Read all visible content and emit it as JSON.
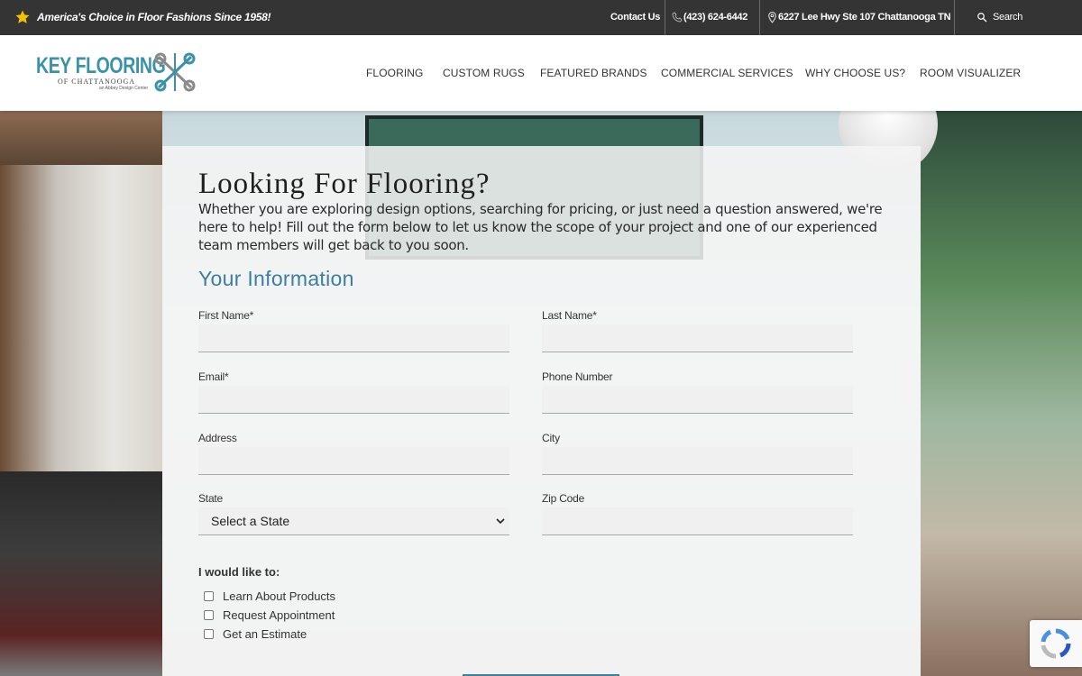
{
  "topbar": {
    "tagline": "America's Choice in Floor Fashions Since 1958!",
    "contact_label": "Contact Us",
    "phone": "(423) 624-6442",
    "address": "6227 Lee Hwy Ste 107 Chattanooga TN",
    "search_label": "Search"
  },
  "logo": {
    "name": "KEY FLOORING",
    "sub": "OF CHATTANOOGA",
    "sub2": "an Abbey Design Center"
  },
  "nav": [
    "FLOORING",
    "CUSTOM RUGS",
    "FEATURED BRANDS",
    "COMMERCIAL SERVICES",
    "WHY CHOOSE US?",
    "ROOM VISUALIZER"
  ],
  "form": {
    "title": "Looking For Flooring?",
    "intro": "Whether you are exploring design options, searching for pricing, or just need a question answered, we're here to help! Fill out the form below to let us know the scope of your project and one of our experienced team members will get back to you soon.",
    "section_title": "Your Information",
    "first_name_label": "First Name*",
    "last_name_label": "Last Name*",
    "email_label": "Email*",
    "phone_label": "Phone Number",
    "address_label": "Address",
    "city_label": "City",
    "state_label": "State",
    "state_value": "Select a State",
    "zip_label": "Zip Code",
    "like_label": "I would like to:",
    "options": [
      "Learn About Products",
      "Request Appointment",
      "Get an Estimate"
    ]
  },
  "colors": {
    "topbar_bg": "#343434",
    "accent": "#3a7fa0",
    "star": "#f2c200"
  }
}
